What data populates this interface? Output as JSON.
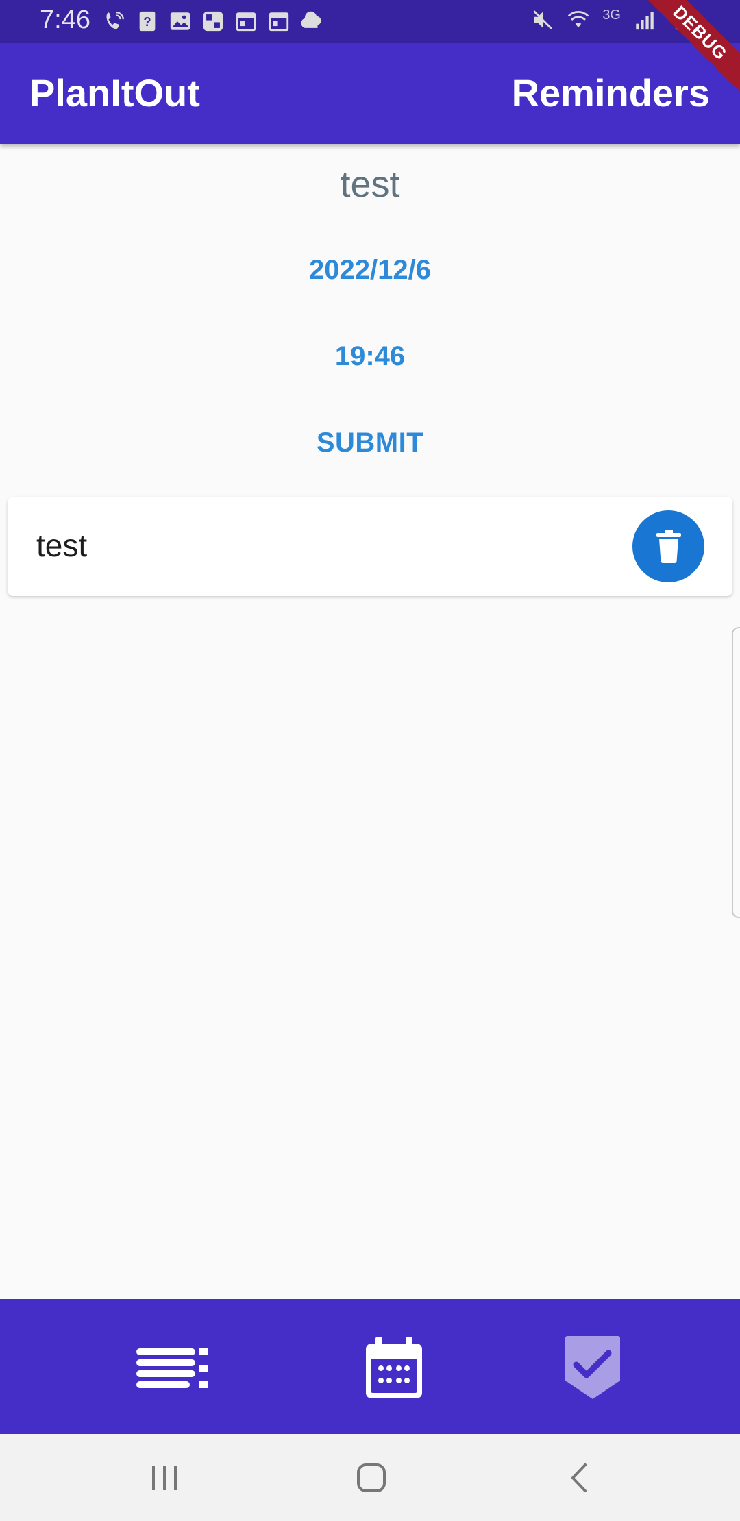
{
  "status_bar": {
    "time": "7:46",
    "network_label": "3G",
    "left_icons": [
      "wifi-call-icon",
      "unknown-app-icon",
      "gallery-icon",
      "grid-app-icon",
      "calendar-app-icon",
      "calendar-app-icon-2",
      "cloud-icon"
    ],
    "right_icons": [
      "mute-icon",
      "wifi-icon",
      "signal-icon",
      "battery-icon"
    ]
  },
  "debug_banner": "DEBUG",
  "app_bar": {
    "title": "PlanItOut",
    "action": "Reminders",
    "color": "#452ec8"
  },
  "form": {
    "title": "test",
    "date": "2022/12/6",
    "time": "19:46",
    "submit_label": "SUBMIT",
    "accent_color": "#2d8ad8"
  },
  "reminders": [
    {
      "label": "test",
      "delete_icon": "trash-icon"
    }
  ],
  "bottom_nav": {
    "items": [
      {
        "icon": "list-icon",
        "active": false
      },
      {
        "icon": "calendar-icon",
        "active": false
      },
      {
        "icon": "checkmark-badge-icon",
        "active": true
      }
    ]
  },
  "system_nav": {
    "buttons": [
      "recent-apps-icon",
      "home-icon",
      "back-icon"
    ]
  }
}
